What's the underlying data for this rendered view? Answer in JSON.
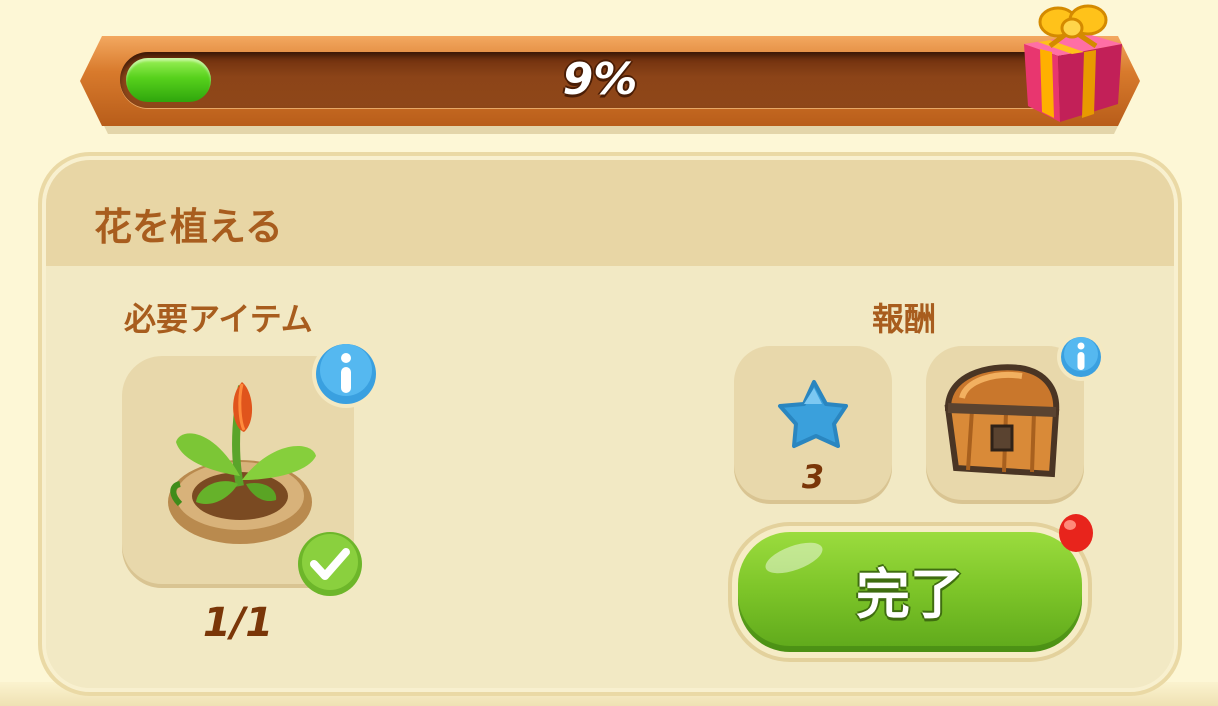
{
  "progress": {
    "percent_label": "9%",
    "fraction": 0.09
  },
  "task": {
    "title": "花を植える",
    "required_label": "必要アイテム",
    "required_item": {
      "icon": "potted-sprout-icon",
      "count_label": "1/1",
      "completed": true
    },
    "rewards_label": "報酬",
    "rewards": [
      {
        "icon": "blue-star-icon",
        "amount_label": "3"
      },
      {
        "icon": "treasure-chest-icon",
        "amount_label": ""
      }
    ],
    "complete_button_label": "完了"
  },
  "colors": {
    "accent_green": "#7cc428",
    "title_brown": "#a85d1e",
    "info_blue": "#3aa0e0"
  }
}
